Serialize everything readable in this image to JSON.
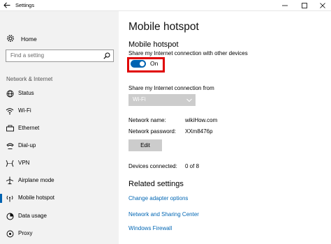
{
  "window": {
    "title": "Settings"
  },
  "sidebar": {
    "home_label": "Home",
    "search_placeholder": "Find a setting",
    "section_label": "Network & Internet",
    "items": [
      {
        "label": "Status",
        "icon": "globe-icon"
      },
      {
        "label": "Wi-Fi",
        "icon": "wifi-icon"
      },
      {
        "label": "Ethernet",
        "icon": "ethernet-icon"
      },
      {
        "label": "Dial-up",
        "icon": "phone-icon"
      },
      {
        "label": "VPN",
        "icon": "vpn-icon"
      },
      {
        "label": "Airplane mode",
        "icon": "airplane-icon"
      },
      {
        "label": "Mobile hotspot",
        "icon": "hotspot-icon",
        "active": true
      },
      {
        "label": "Data usage",
        "icon": "data-usage-icon"
      },
      {
        "label": "Proxy",
        "icon": "proxy-icon"
      }
    ]
  },
  "main": {
    "title": "Mobile hotspot",
    "hotspot_heading": "Mobile hotspot",
    "hotspot_description": "Share my Internet connection with other devices",
    "toggle_state": "On",
    "share_from_label": "Share my Internet connection from",
    "share_from_value": "Wi-Fi",
    "network_name_label": "Network name:",
    "network_name_value": "wikiHow.com",
    "network_password_label": "Network password:",
    "network_password_value": "XXm8476p",
    "edit_label": "Edit",
    "devices_label": "Devices connected:",
    "devices_value": "0 of 8",
    "related_heading": "Related settings",
    "related_links": [
      "Change adapter options",
      "Network and Sharing Center",
      "Windows Firewall"
    ]
  },
  "colors": {
    "accent": "#0063b1",
    "link": "#0066b4",
    "highlight": "#e00000",
    "sidebar_bg": "#f2f2f2"
  }
}
